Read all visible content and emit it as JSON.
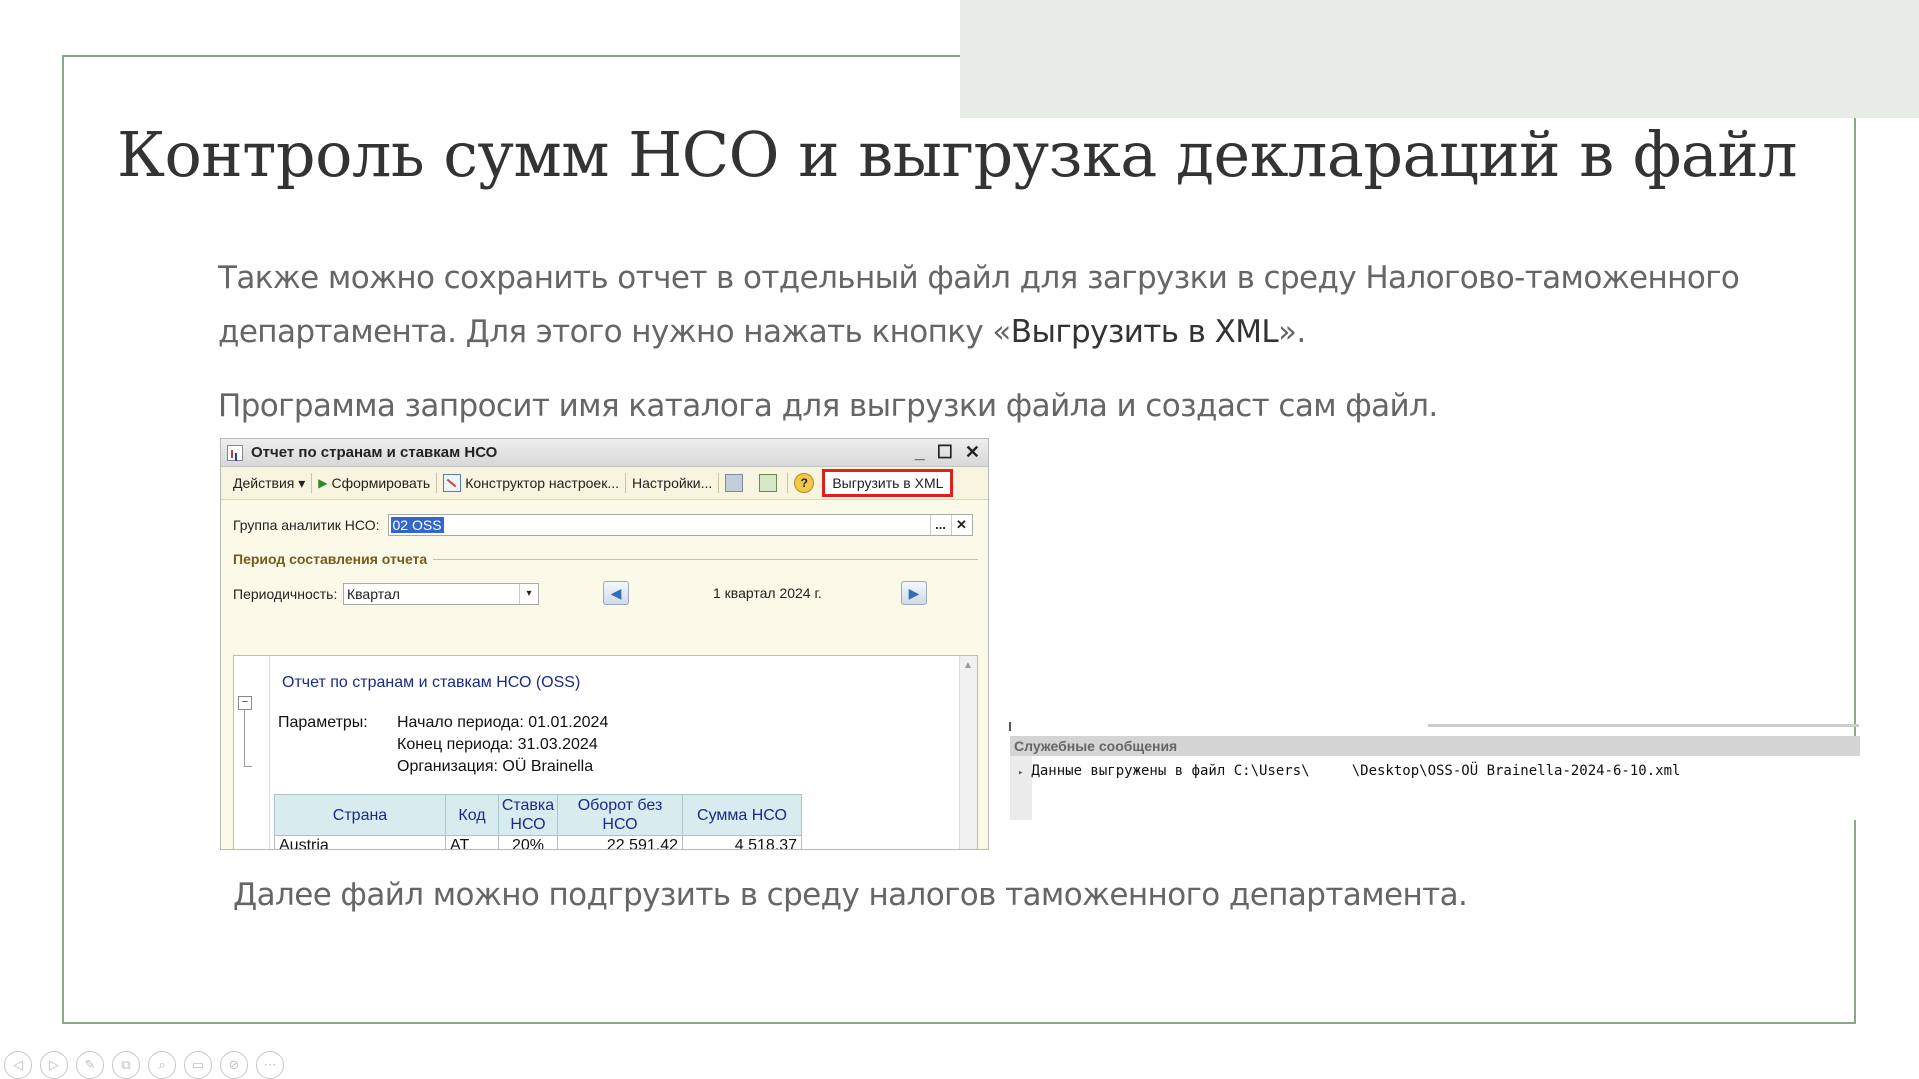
{
  "slide": {
    "title": "Контроль сумм НСО и выгрузка деклараций в файл",
    "paragraph1_before": "Также можно сохранить отчет в отдельный файл для загрузки в среду Налогово-таможенного департамента. Для этого нужно нажать кнопку «",
    "paragraph1_highlight": "Выгрузить в XML",
    "paragraph1_after": "».",
    "paragraph2": "Программа запросит имя каталога для выгрузки файла и создаст сам файл.",
    "paragraph3": "Далее файл можно подгрузить в среду налогов таможенного департамента."
  },
  "window": {
    "title": "Отчет по странам и ставкам НСО",
    "controls": {
      "minimize": "_",
      "maximize": "☐",
      "close": "✕"
    },
    "toolbar": {
      "actions": "Действия ▾",
      "generate": "Сформировать",
      "constructor": "Конструктор настроек...",
      "settings": "Настройки...",
      "help": "?",
      "export_xml": "Выгрузить в XML"
    },
    "group_label": "Группа аналитик НСО:",
    "group_value": "02 OSS",
    "group_select": "...",
    "group_clear": "✕",
    "period_section": "Период составления отчета",
    "periodicity_label": "Периодичность:",
    "periodicity_value": "Квартал",
    "combo_arrow": "▾",
    "nav_prev": "◀",
    "nav_next": "▶",
    "period_text": "1 квартал 2024 г.",
    "report": {
      "collapse": "−",
      "scroll_up": "▲",
      "title": "Отчет по странам и ставкам НСО (OSS)",
      "params_label": "Параметры:",
      "param_start": "Начало периода: 01.01.2024",
      "param_end": "Конец периода: 31.03.2024",
      "param_org": "Организация: OÜ Brainella",
      "columns": [
        "Страна",
        "Код",
        "Ставка НСО",
        "Оборот без НСО",
        "Сумма НСО"
      ],
      "rows": [
        [
          "Austria",
          "AT",
          "20%",
          "22 591,42",
          "4 518,37"
        ]
      ]
    }
  },
  "messages": {
    "header": "Служебные сообщения",
    "text": "Данные выгружены в файл C:\\Users\\     \\Desktop\\OSS-OÜ Brainella-2024-6-10.xml"
  },
  "presenter": {
    "icons": [
      "prev-icon",
      "next-icon",
      "pen-icon",
      "slides-icon",
      "zoom-icon",
      "subtitle-icon",
      "camera-off-icon",
      "more-icon"
    ],
    "glyphs": [
      "◁",
      "▷",
      "✎",
      "⧉",
      "⌕",
      "▭",
      "⊘",
      "⋯"
    ]
  }
}
